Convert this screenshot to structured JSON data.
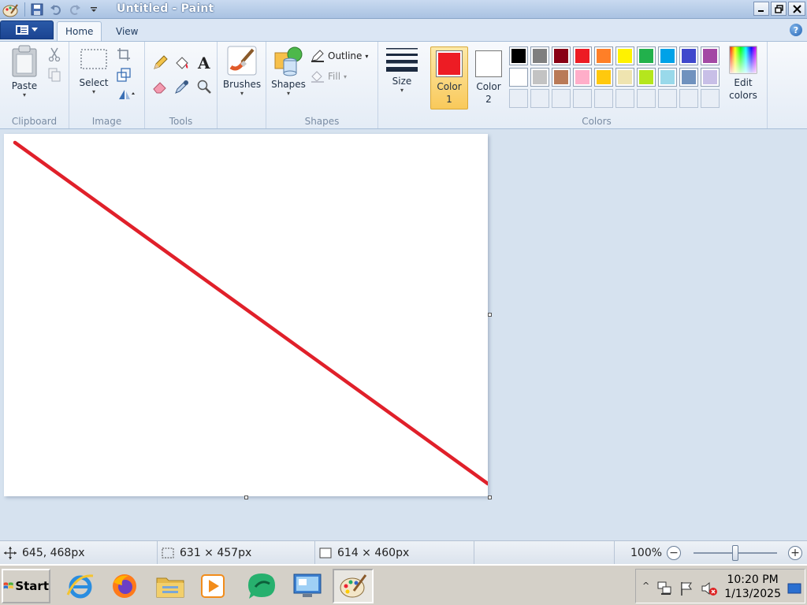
{
  "window": {
    "title": "Untitled - Paint"
  },
  "menu": {
    "file_icon": "paint-menu-icon"
  },
  "tabs": [
    {
      "label": "Home",
      "active": true
    },
    {
      "label": "View",
      "active": false
    }
  ],
  "ribbon": {
    "clipboard": {
      "group_label": "Clipboard",
      "paste_label": "Paste"
    },
    "image": {
      "group_label": "Image",
      "select_label": "Select"
    },
    "tools": {
      "group_label": "Tools"
    },
    "brushes": {
      "label": "Brushes"
    },
    "shapes": {
      "group_label": "Shapes",
      "shapes_label": "Shapes",
      "outline_label": "Outline",
      "fill_label": "Fill"
    },
    "size": {
      "label": "Size"
    },
    "colors": {
      "group_label": "Colors",
      "color1_label": "Color\n1",
      "color1_value": "#ed1c24",
      "color2_label": "Color\n2",
      "color2_value": "#ffffff",
      "edit_colors_label": "Edit colors",
      "palette_row1": [
        "#000000",
        "#7f7f7f",
        "#880015",
        "#ed1c24",
        "#ff7f27",
        "#fff200",
        "#22b14c",
        "#00a2e8",
        "#3f48cc",
        "#a349a4"
      ],
      "palette_row2": [
        "#ffffff",
        "#c3c3c3",
        "#b97a57",
        "#ffaec9",
        "#ffc90e",
        "#efe4b0",
        "#b5e61d",
        "#99d9ea",
        "#7092be",
        "#c8bfe7"
      ]
    }
  },
  "canvas": {
    "line_color": "#e0202a"
  },
  "status": {
    "cursor_pos": "645, 468px",
    "selection_size": "631 × 457px",
    "image_size": "614 × 460px",
    "zoom": "100%"
  },
  "taskbar": {
    "start_label": "Start",
    "time": "10:20 PM",
    "date": "1/13/2025"
  }
}
